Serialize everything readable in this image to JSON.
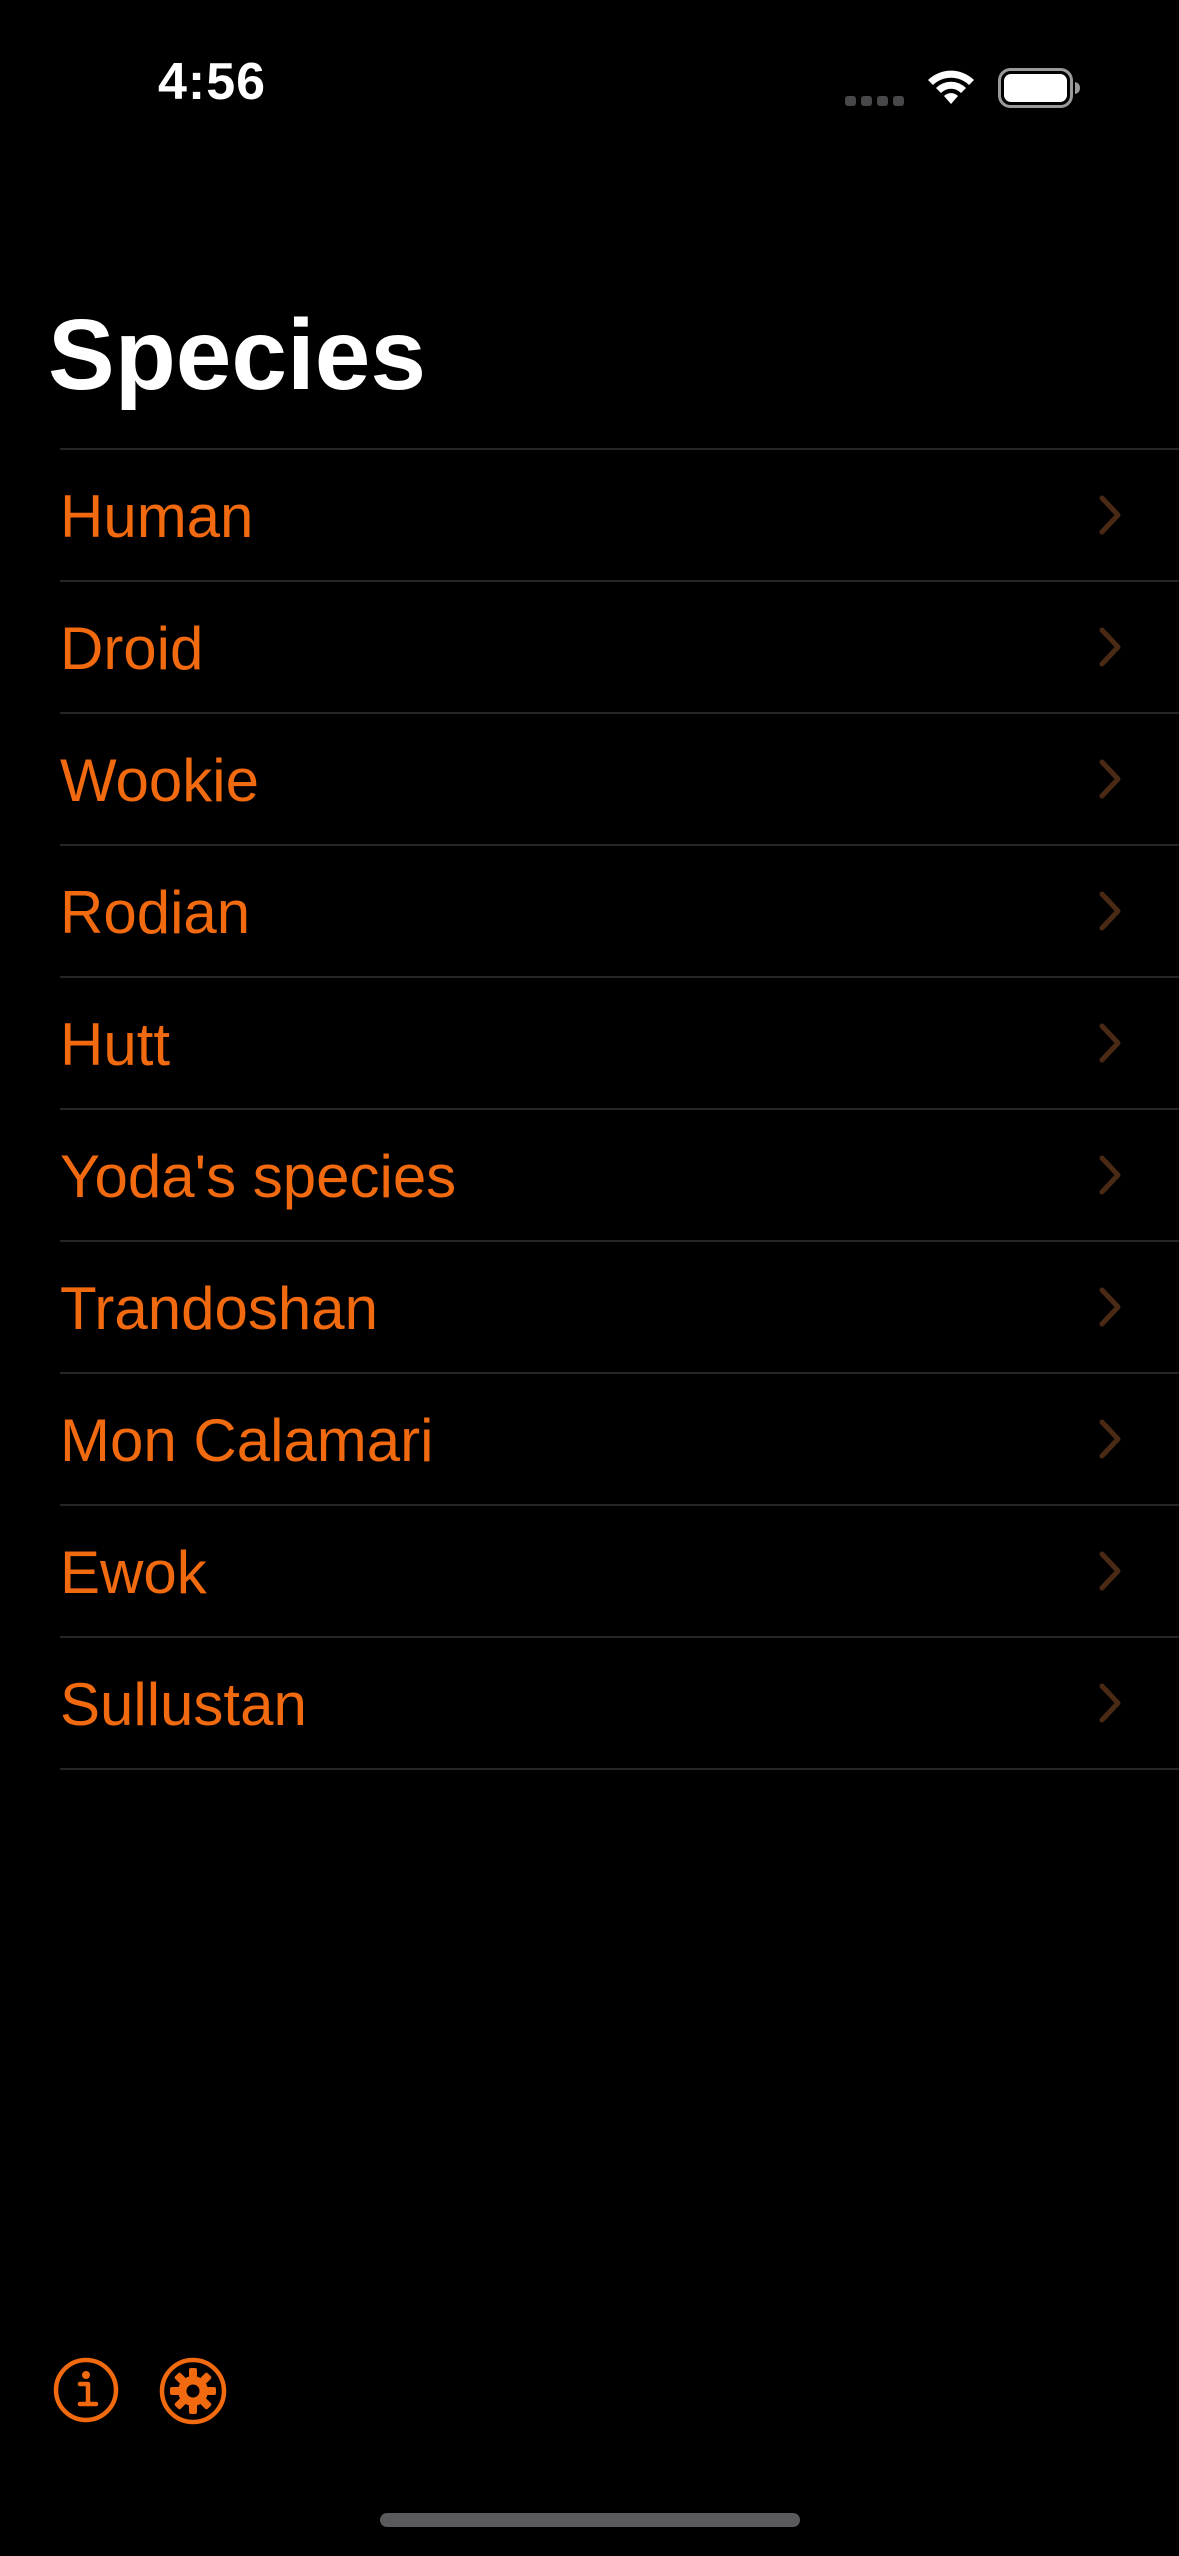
{
  "status_bar": {
    "time": "4:56",
    "icons": [
      "cellular-signal-icon",
      "wifi-icon",
      "battery-icon"
    ]
  },
  "navigation": {
    "title": "Species"
  },
  "species_list": {
    "items": [
      {
        "label": "Human"
      },
      {
        "label": "Droid"
      },
      {
        "label": "Wookie"
      },
      {
        "label": "Rodian"
      },
      {
        "label": "Hutt"
      },
      {
        "label": "Yoda's species"
      },
      {
        "label": "Trandoshan"
      },
      {
        "label": "Mon Calamari"
      },
      {
        "label": "Ewok"
      },
      {
        "label": "Sullustan"
      }
    ]
  },
  "toolbar": {
    "icons": [
      "info-icon",
      "gear-icon"
    ]
  },
  "colors": {
    "background": "#000000",
    "accent": "#f26a0f",
    "chevron": "#4a2a14",
    "separator": "#262628",
    "title": "#ffffff"
  }
}
